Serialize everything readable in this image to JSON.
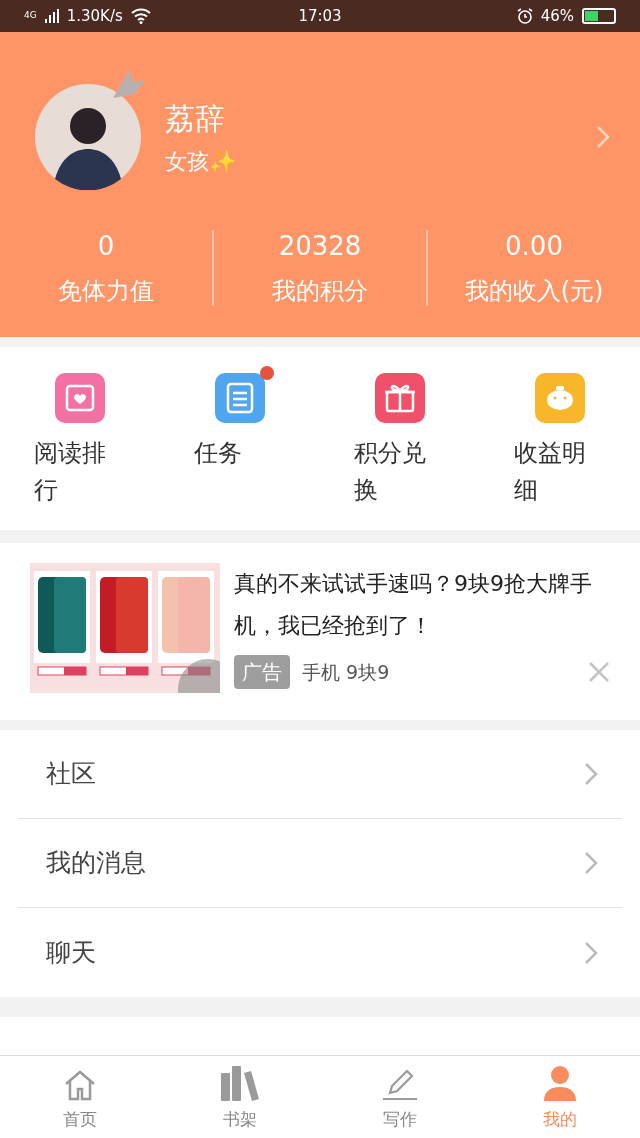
{
  "status_bar": {
    "network": "4G",
    "speed": "1.30K/s",
    "time": "17:03",
    "battery": "46%"
  },
  "profile": {
    "name": "荔辞",
    "subtitle": "女孩✨"
  },
  "stats": [
    {
      "value": "0",
      "label": "免体力值"
    },
    {
      "value": "20328",
      "label": "我的积分"
    },
    {
      "value": "0.00",
      "label": "我的收入(元)"
    }
  ],
  "shortcuts": [
    {
      "kind": "ranking",
      "label": "阅读排行",
      "badge": false
    },
    {
      "kind": "tasks",
      "label": "任务",
      "badge": true
    },
    {
      "kind": "exchange",
      "label": "积分兑换",
      "badge": false
    },
    {
      "kind": "earnings",
      "label": "收益明细",
      "badge": false
    }
  ],
  "ad": {
    "headline": "真的不来试试手速吗？9块9抢大牌手机，我已经抢到了！",
    "tag": "广告",
    "source": "手机 9块9"
  },
  "menu": [
    {
      "label": "社区"
    },
    {
      "label": "我的消息"
    },
    {
      "label": "聊天"
    }
  ],
  "tabs": [
    {
      "kind": "home",
      "label": "首页",
      "selected": false
    },
    {
      "kind": "shelf",
      "label": "书架",
      "selected": false
    },
    {
      "kind": "write",
      "label": "写作",
      "selected": false
    },
    {
      "kind": "me",
      "label": "我的",
      "selected": true
    }
  ]
}
